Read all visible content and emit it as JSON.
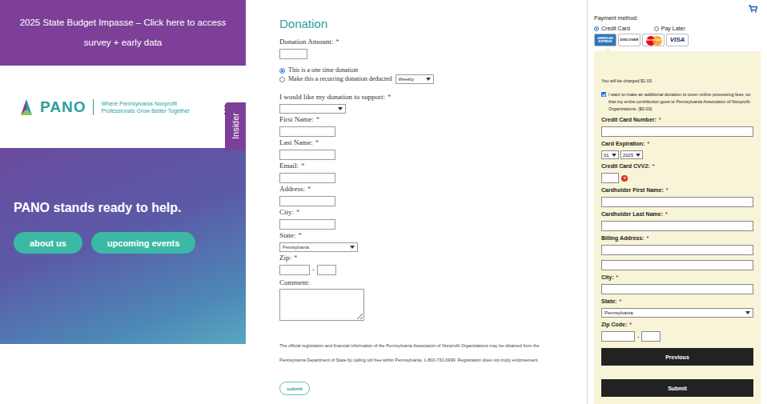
{
  "banner": {
    "text": "2025 State Budget Impasse – Click here to access survey + early data"
  },
  "logo": {
    "name": "PANO",
    "tagline": [
      "Where Pennsylvania Nonprofit",
      "Professionals Grow Better Together"
    ]
  },
  "insider_tab": {
    "label": "Insider",
    "dots": "⋮"
  },
  "hero": {
    "heading": "PANO stands ready to help.",
    "buttons": [
      "about us",
      "upcoming events"
    ]
  },
  "donation": {
    "title": "Donation",
    "required_mark": "*",
    "amount": {
      "label": "Donation Amount:",
      "required": true
    },
    "frequency": [
      {
        "label": "This is a one time donation",
        "selected": true,
        "kind": "plain"
      },
      {
        "label": "Make this a recurring donation deducted",
        "selected": false,
        "kind": "with-select",
        "option": "Weekly"
      }
    ],
    "fields": [
      {
        "label": "I would like my donation to support:",
        "required": true,
        "kind": "select",
        "value": ""
      },
      {
        "label": "First Name:",
        "required": true,
        "kind": "text"
      },
      {
        "label": "Last Name:",
        "required": true,
        "kind": "text"
      },
      {
        "label": "Email:",
        "required": true,
        "kind": "text"
      },
      {
        "label": "Address:",
        "required": true,
        "kind": "text"
      },
      {
        "label": "City:",
        "required": true,
        "kind": "text"
      },
      {
        "label": "State:",
        "required": true,
        "kind": "select",
        "value": "Pennsylvania"
      },
      {
        "label": "Zip:",
        "required": true,
        "kind": "zip",
        "separator": "-"
      },
      {
        "label": "Comment:",
        "required": false,
        "kind": "textarea"
      }
    ],
    "disclaimer": [
      "The official registration and financial information of the Pennsylvania Association of Nonprofit Organizations may be obtained from the",
      "Pennsylvania Department of State by calling toll free within Pennsylvania, 1-800-732-0999.  Registration does not imply endorsement"
    ],
    "submit": "submit"
  },
  "payment": {
    "method_label": "Payment method:",
    "methods": [
      {
        "label": "Credit Card",
        "selected": true
      },
      {
        "label": "Pay Later",
        "selected": false
      }
    ],
    "cards": [
      {
        "label": "AMERICAN EXPRESS",
        "kind": "amex"
      },
      {
        "label": "DISCOVER",
        "kind": "discover"
      },
      {
        "label": "MasterCard",
        "kind": "mastercard"
      },
      {
        "label": "VISA",
        "kind": "visa"
      }
    ],
    "charge": "You will be charged $1.03 .",
    "fee_option": {
      "checked": true,
      "label": "I want to make an additional donation to cover online processing fees, so that my entire contribution goes to Pennsylvania Association of Nonprofit Organizations. ($0.03)"
    },
    "required_mark": "*",
    "fields": [
      {
        "label": "Credit Card Number:",
        "kind": "text"
      },
      {
        "label": "Card Expiration:",
        "kind": "expiry",
        "month": "01",
        "year": "2025"
      },
      {
        "label": "Credit Card CVV2:",
        "kind": "cvv",
        "help": "?"
      },
      {
        "label": "Cardholder First Name:",
        "kind": "text"
      },
      {
        "label": "Cardholder Last Name:",
        "kind": "text"
      },
      {
        "label": "Billing Address:",
        "kind": "address"
      },
      {
        "label": "City:",
        "kind": "text"
      },
      {
        "label": "State:",
        "kind": "select",
        "value": "Pennsylvania"
      },
      {
        "label": "Zip Code:",
        "kind": "zip",
        "separator": "-"
      }
    ],
    "buttons": [
      "Previous",
      "Submit"
    ]
  }
}
